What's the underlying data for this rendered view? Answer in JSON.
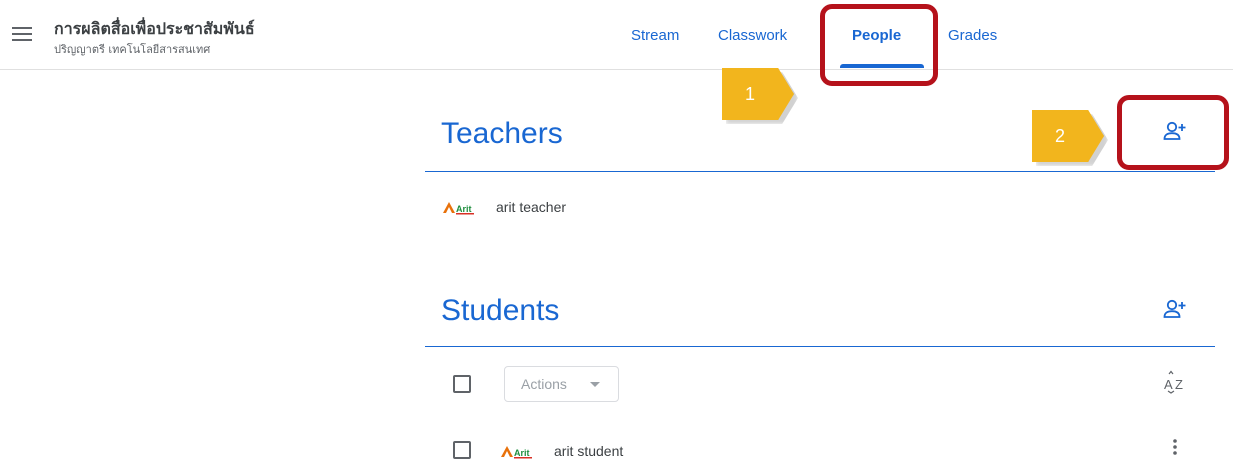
{
  "header": {
    "class_title": "การผลิตสื่อเพื่อประชาสัมพันธ์",
    "class_subtitle": "ปริญญาตรี เทคโนโลยีสารสนเทศ",
    "menu_icon": "hamburger-menu-icon"
  },
  "tabs": [
    {
      "label": "Stream",
      "active": false
    },
    {
      "label": "Classwork",
      "active": false
    },
    {
      "label": "People",
      "active": true
    },
    {
      "label": "Grades",
      "active": false
    }
  ],
  "annotations": {
    "step1": "1",
    "step2": "2",
    "marker_color": "#f2b51d",
    "box_color": "#b5121b"
  },
  "teachers": {
    "title": "Teachers",
    "add_icon": "invite-person-icon",
    "people": [
      {
        "name": "arit teacher",
        "logo_text": "Arit"
      }
    ]
  },
  "students": {
    "title": "Students",
    "add_icon": "invite-person-icon",
    "actions_label": "Actions",
    "sort_icon": "sort-az-icon",
    "people": [
      {
        "name": "arit student",
        "logo_text": "Arit"
      }
    ]
  },
  "colors": {
    "accent": "#1967d2",
    "text": "#3c4043",
    "muted": "#9aa0a6"
  }
}
